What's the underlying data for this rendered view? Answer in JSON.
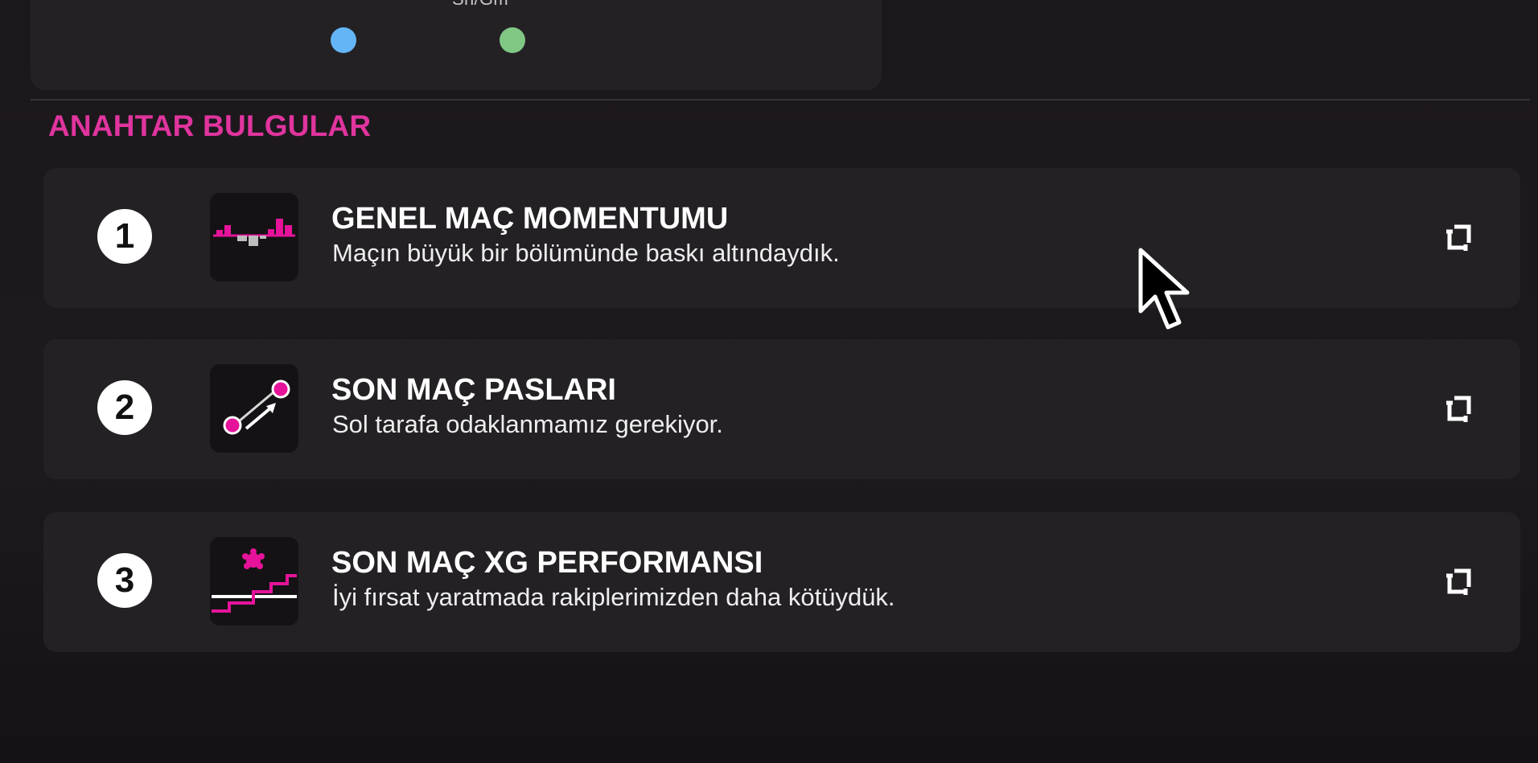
{
  "legend": {
    "label": "Sh/Gm",
    "dots": [
      {
        "color": "#64b5f6"
      },
      {
        "color": "#81c784"
      }
    ]
  },
  "section": {
    "title": "ANAHTAR BULGULAR"
  },
  "findings": [
    {
      "number": "1",
      "title": "GENEL MAÇ MOMENTUMU",
      "subtitle": "Maçın büyük bir bölümünde baskı altındaydık.",
      "icon": "momentum-bars-icon"
    },
    {
      "number": "2",
      "title": "SON MAÇ PASLARI",
      "subtitle": "Sol tarafa odaklanmamız gerekiyor.",
      "icon": "passes-arrow-icon"
    },
    {
      "number": "3",
      "title": "SON MAÇ XG PERFORMANSI",
      "subtitle": "İyi fırsat yaratmada rakiplerimizden daha kötüydük.",
      "icon": "xg-steps-icon"
    }
  ],
  "colors": {
    "accent": "#e0349e",
    "card_bg": "#242125",
    "page_bg": "#1b181b"
  }
}
